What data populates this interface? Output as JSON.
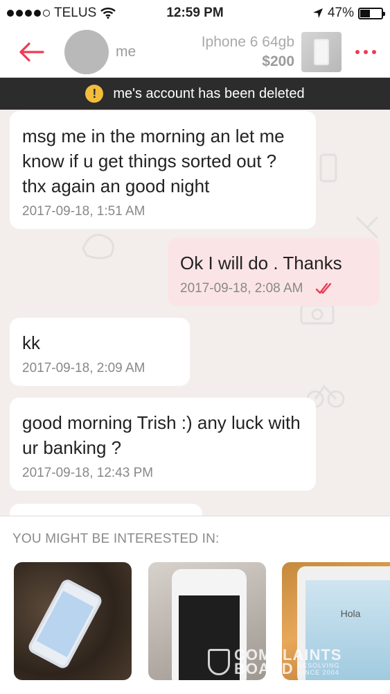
{
  "status_bar": {
    "carrier": "TELUS",
    "time": "12:59 PM",
    "battery": "47%",
    "battery_level": 0.47
  },
  "header": {
    "back_icon": "arrow-left-icon",
    "username": "me",
    "item_title": "Iphone 6 64gb",
    "item_price": "$200",
    "more_icon": "more-dots-icon",
    "accent": "#ee3a52"
  },
  "banner": {
    "text": "me's account has been deleted",
    "icon": "warning-icon"
  },
  "messages": [
    {
      "direction": "in",
      "text": "msg me in the morning an let me know if u get things sorted out ? thx again an good night",
      "time": "2017-09-18, 1:51 AM"
    },
    {
      "direction": "out",
      "text": "Ok I will do . Thanks",
      "time": "2017-09-18, 2:08 AM",
      "read_icon": "double-check-icon"
    },
    {
      "direction": "in",
      "text": "kk",
      "time": "2017-09-18, 2:09 AM"
    },
    {
      "direction": "in",
      "text": "good morning Trish :) any luck with ur banking ?",
      "time": "2017-09-18, 12:43 PM"
    }
  ],
  "suggestions": {
    "title": "YOU MIGHT BE INTERESTED IN:",
    "cards": [
      {
        "alt": "phone-photo-1"
      },
      {
        "alt": "phone-photo-2"
      },
      {
        "alt": "phone-photo-3",
        "screen_text": "Hola"
      }
    ]
  },
  "watermark": {
    "line1": "COMPLAINTS",
    "line2": "BOARD",
    "sub1": "RESOLVING",
    "sub2": "SINCE 2004"
  }
}
